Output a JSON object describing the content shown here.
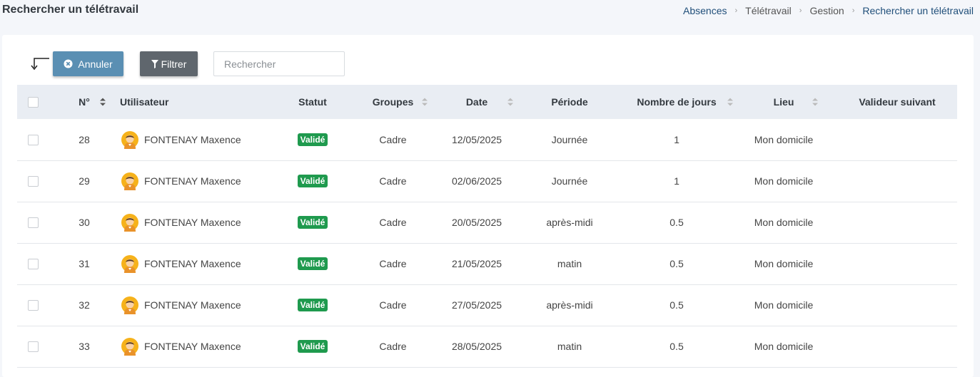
{
  "header": {
    "title": "Rechercher un télétravail",
    "breadcrumb": [
      "Absences",
      "Télétravail",
      "Gestion",
      "Rechercher un télétravail"
    ]
  },
  "toolbar": {
    "cancel_label": "Annuler",
    "filter_label": "Filtrer",
    "search_placeholder": "Rechercher"
  },
  "table": {
    "columns": {
      "num": "N°",
      "user": "Utilisateur",
      "status": "Statut",
      "groups": "Groupes",
      "date": "Date",
      "period": "Période",
      "days": "Nombre de jours",
      "place": "Lieu",
      "validator": "Valideur suivant"
    },
    "rows": [
      {
        "num": "28",
        "user": "FONTENAY Maxence",
        "status": "Validé",
        "group": "Cadre",
        "date": "12/05/2025",
        "period": "Journée",
        "days": "1",
        "place": "Mon domicile",
        "validator": ""
      },
      {
        "num": "29",
        "user": "FONTENAY Maxence",
        "status": "Validé",
        "group": "Cadre",
        "date": "02/06/2025",
        "period": "Journée",
        "days": "1",
        "place": "Mon domicile",
        "validator": ""
      },
      {
        "num": "30",
        "user": "FONTENAY Maxence",
        "status": "Validé",
        "group": "Cadre",
        "date": "20/05/2025",
        "period": "après-midi",
        "days": "0.5",
        "place": "Mon domicile",
        "validator": ""
      },
      {
        "num": "31",
        "user": "FONTENAY Maxence",
        "status": "Validé",
        "group": "Cadre",
        "date": "21/05/2025",
        "period": "matin",
        "days": "0.5",
        "place": "Mon domicile",
        "validator": ""
      },
      {
        "num": "32",
        "user": "FONTENAY Maxence",
        "status": "Validé",
        "group": "Cadre",
        "date": "27/05/2025",
        "period": "après-midi",
        "days": "0.5",
        "place": "Mon domicile",
        "validator": ""
      },
      {
        "num": "33",
        "user": "FONTENAY Maxence",
        "status": "Validé",
        "group": "Cadre",
        "date": "28/05/2025",
        "period": "matin",
        "days": "0.5",
        "place": "Mon domicile",
        "validator": ""
      }
    ]
  },
  "colors": {
    "accent": "#1f4e79",
    "cancel_button": "#5a8fb3",
    "filter_button": "#5f666d",
    "status_valid": "#1f9a4e",
    "header_bg": "#e9edf3"
  }
}
